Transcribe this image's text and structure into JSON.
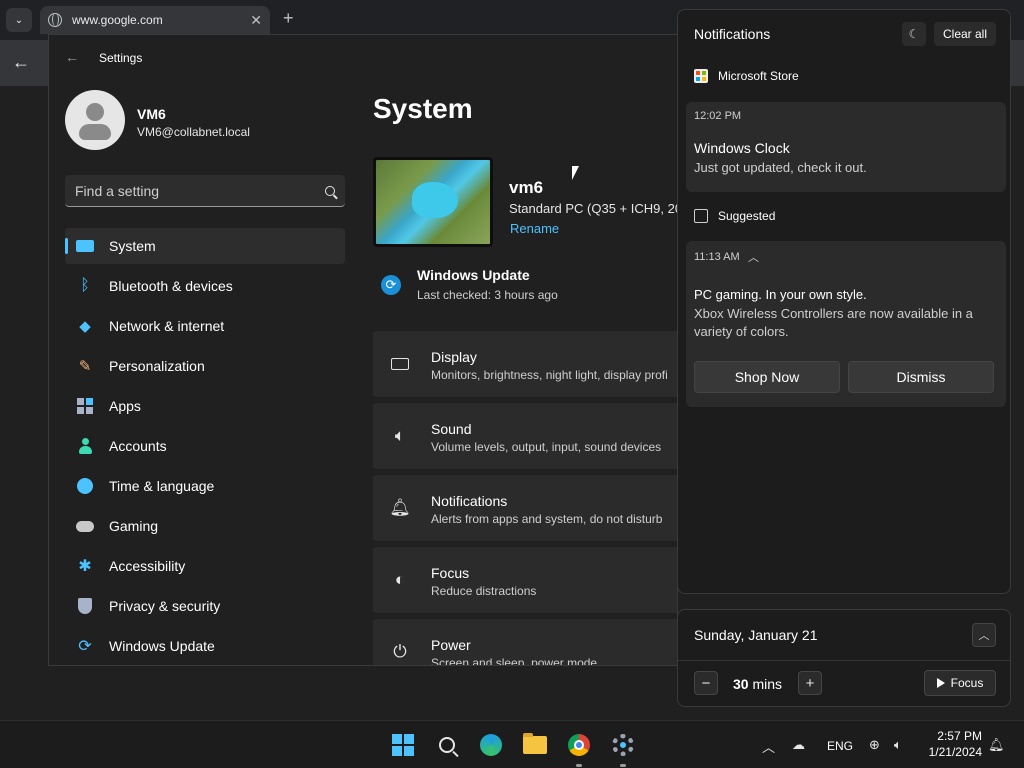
{
  "browser": {
    "tab_title": "www.google.com",
    "tab_close": "✕",
    "new_tab": "+",
    "back": "←",
    "tab_list": "⌄"
  },
  "settings": {
    "window_title": "Settings",
    "back_arrow": "←",
    "user_name": "VM6",
    "user_email": "VM6@collabnet.local",
    "search_placeholder": "Find a setting",
    "nav": [
      {
        "label": "System",
        "icon": "system-icon",
        "active": true
      },
      {
        "label": "Bluetooth & devices",
        "icon": "bluetooth-icon"
      },
      {
        "label": "Network & internet",
        "icon": "wifi-icon"
      },
      {
        "label": "Personalization",
        "icon": "brush-icon"
      },
      {
        "label": "Apps",
        "icon": "apps-icon"
      },
      {
        "label": "Accounts",
        "icon": "accounts-icon"
      },
      {
        "label": "Time & language",
        "icon": "globe-clock-icon"
      },
      {
        "label": "Gaming",
        "icon": "gamepad-icon"
      },
      {
        "label": "Accessibility",
        "icon": "accessibility-icon"
      },
      {
        "label": "Privacy & security",
        "icon": "shield-icon"
      },
      {
        "label": "Windows Update",
        "icon": "update-icon"
      }
    ],
    "page_title": "System",
    "pc_name": "vm6",
    "pc_model": "Standard PC (Q35 + ICH9, 20",
    "rename_label": "Rename",
    "windows_update": {
      "title": "Windows Update",
      "subtitle": "Last checked: 3 hours ago"
    },
    "cards": [
      {
        "title": "Display",
        "subtitle": "Monitors, brightness, night light, display profi",
        "icon": "display-icon"
      },
      {
        "title": "Sound",
        "subtitle": "Volume levels, output, input, sound devices",
        "icon": "speaker-icon"
      },
      {
        "title": "Notifications",
        "subtitle": "Alerts from apps and system, do not disturb",
        "icon": "bell-icon"
      },
      {
        "title": "Focus",
        "subtitle": "Reduce distractions",
        "icon": "focus-icon"
      },
      {
        "title": "Power",
        "subtitle": "Screen and sleep, power mode",
        "icon": "power-icon"
      }
    ]
  },
  "notifications": {
    "header": "Notifications",
    "clear_all": "Clear all",
    "groups": [
      {
        "app": "Microsoft Store",
        "time": "12:02 PM",
        "title": "Windows Clock",
        "body": "Just got updated, check it out."
      },
      {
        "app": "Suggested",
        "time": "11:13 AM",
        "title": "PC gaming. In your own style.",
        "body": "Xbox Wireless Controllers are now available in a variety of colors.",
        "buttons": [
          "Shop Now",
          "Dismiss"
        ]
      }
    ]
  },
  "calendar": {
    "date": "Sunday, January 21",
    "focus_minutes": "30",
    "focus_unit": "mins",
    "focus_label": "Focus",
    "minus": "−",
    "plus": "+"
  },
  "taskbar": {
    "tray_language": "ENG",
    "clock_time": "2:57 PM",
    "clock_date": "1/21/2024"
  }
}
